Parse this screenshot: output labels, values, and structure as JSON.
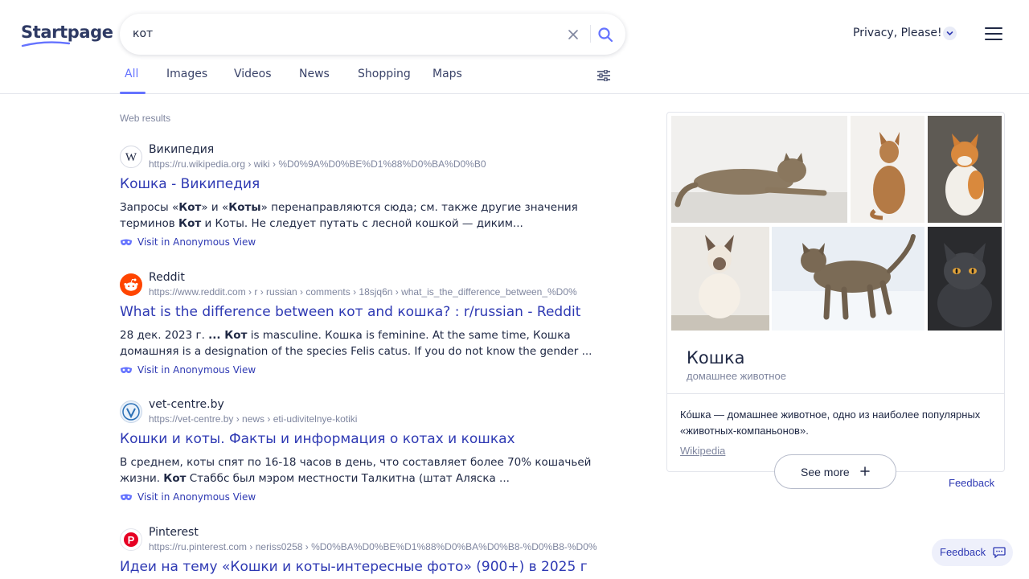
{
  "header": {
    "logo_text": "Startpage",
    "search": {
      "value": "кот",
      "placeholder": ""
    },
    "privacy_label": "Privacy, Please!"
  },
  "tabs": [
    {
      "label": "All",
      "active": true
    },
    {
      "label": "Images",
      "active": false
    },
    {
      "label": "Videos",
      "active": false
    },
    {
      "label": "News",
      "active": false
    },
    {
      "label": "Shopping",
      "active": false
    },
    {
      "label": "Maps",
      "active": false
    }
  ],
  "results_label": "Web results",
  "results": [
    {
      "site": "Википедия",
      "url": "https://ru.wikipedia.org › wiki › %D0%9A%D0%BE%D1%88%D0%BA%D0%B0",
      "title": "Кошка - Википедия",
      "snippet_parts": [
        {
          "t": "Запросы «",
          "b": false
        },
        {
          "t": "Кот",
          "b": true
        },
        {
          "t": "» и «",
          "b": false
        },
        {
          "t": "Коты",
          "b": true
        },
        {
          "t": "» перенаправляются сюда; см. также другие значения терминов ",
          "b": false
        },
        {
          "t": "Кот",
          "b": true
        },
        {
          "t": " и Коты. Не следует путать с лесной кошкой — диким...",
          "b": false
        }
      ],
      "anon_label": "Visit in Anonymous View",
      "favicon": "wikipedia-icon"
    },
    {
      "site": "Reddit",
      "url": "https://www.reddit.com › r › russian › comments › 18sjq6n › what_is_the_difference_between_%D0%",
      "title": "What is the difference between кот and кошка? : r/russian - Reddit",
      "snippet_parts": [
        {
          "t": "28 дек. 2023 г. ",
          "b": false
        },
        {
          "t": "... Кот",
          "b": true
        },
        {
          "t": " is masculine. Кошка is feminine. At the same time, Кошка домашняя is a designation of the species Felis catus. If you do not know the gender ...",
          "b": false
        }
      ],
      "anon_label": "Visit in Anonymous View",
      "favicon": "reddit-icon"
    },
    {
      "site": "vet-centre.by",
      "url": "https://vet-centre.by › news › eti-udivitelnye-kotiki",
      "title": "Кошки и коты. Факты и информация о котах и кошках",
      "snippet_parts": [
        {
          "t": "В среднем, коты спят по 16-18 часов в день, что составляет более 70% кошачьей жизни. ",
          "b": false
        },
        {
          "t": "Кот",
          "b": true
        },
        {
          "t": " Стаббс был мэром местности Талкитна (штат Аляска ...",
          "b": false
        }
      ],
      "anon_label": "Visit in Anonymous View",
      "favicon": "vet-centre-icon"
    },
    {
      "site": "Pinterest",
      "url": "https://ru.pinterest.com › neriss0258 › %D0%BA%D0%BE%D1%88%D0%BA%D0%B8-%D0%B8-%D0%",
      "title": "Идеи на тему «Кошки и коты-интересные фото» (900+) в 2025 г",
      "snippet_parts": [],
      "anon_label": "",
      "favicon": "pinterest-icon"
    }
  ],
  "panel": {
    "title": "Кошка",
    "subtitle": "домашнее животное",
    "description": "Ко́шка — домашнее животное, одно из наиболее популярных «животных-компаньонов».",
    "source": "Wikipedia",
    "see_more": "See more",
    "feedback": "Feedback"
  },
  "feedback_button": "Feedback",
  "colors": {
    "accent": "#6573ff",
    "link": "#2e39b3",
    "text": "#202945",
    "muted": "#7f869f"
  }
}
